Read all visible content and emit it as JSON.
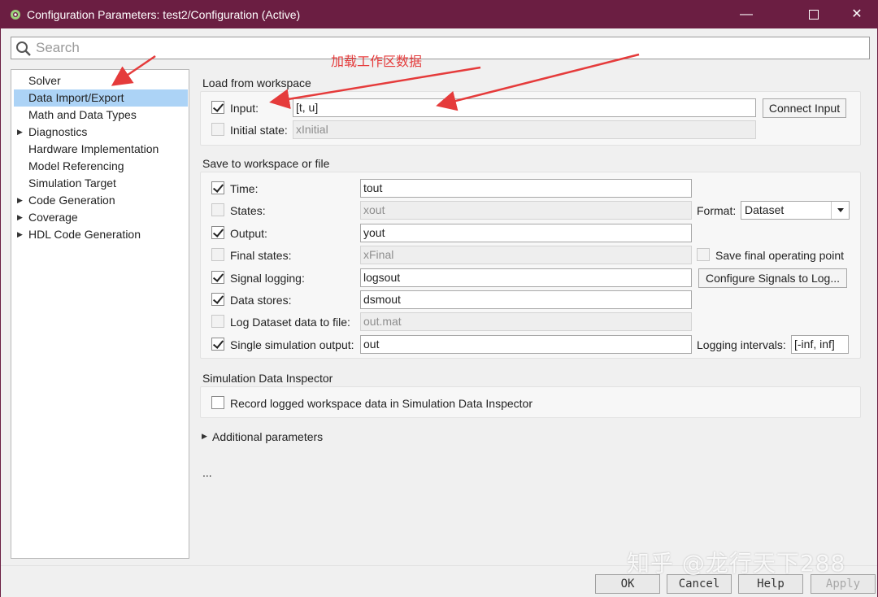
{
  "window": {
    "title": "Configuration Parameters: test2/Configuration (Active)"
  },
  "search": {
    "placeholder": "Search"
  },
  "tree": {
    "items": [
      {
        "label": "Solver",
        "expandable": false,
        "selected": false
      },
      {
        "label": "Data Import/Export",
        "expandable": false,
        "selected": true
      },
      {
        "label": "Math and Data Types",
        "expandable": false,
        "selected": false
      },
      {
        "label": "Diagnostics",
        "expandable": true,
        "selected": false
      },
      {
        "label": "Hardware Implementation",
        "expandable": false,
        "selected": false
      },
      {
        "label": "Model Referencing",
        "expandable": false,
        "selected": false
      },
      {
        "label": "Simulation Target",
        "expandable": false,
        "selected": false
      },
      {
        "label": "Code Generation",
        "expandable": true,
        "selected": false
      },
      {
        "label": "Coverage",
        "expandable": true,
        "selected": false
      },
      {
        "label": "HDL Code Generation",
        "expandable": true,
        "selected": false
      }
    ]
  },
  "load": {
    "section_title": "Load from workspace",
    "input": {
      "label": "Input:",
      "value": "[t, u]",
      "checked": true
    },
    "initial_state": {
      "label": "Initial state:",
      "value": "xInitial",
      "checked": false
    },
    "connect_button": "Connect Input"
  },
  "save": {
    "section_title": "Save to workspace or file",
    "time": {
      "label": "Time:",
      "value": "tout",
      "checked": true
    },
    "states": {
      "label": "States:",
      "value": "xout",
      "checked": false
    },
    "output": {
      "label": "Output:",
      "value": "yout",
      "checked": true
    },
    "final_states": {
      "label": "Final states:",
      "value": "xFinal",
      "checked": false
    },
    "signal_logging": {
      "label": "Signal logging:",
      "value": "logsout",
      "checked": true
    },
    "data_stores": {
      "label": "Data stores:",
      "value": "dsmout",
      "checked": true
    },
    "log_dataset": {
      "label": "Log Dataset data to file:",
      "value": "out.mat",
      "checked": false
    },
    "single_output": {
      "label": "Single simulation output:",
      "value": "out",
      "checked": true
    },
    "format_label": "Format:",
    "format_value": "Dataset",
    "save_final_op": "Save final operating point",
    "configure_signals_button": "Configure Signals to Log...",
    "logging_intervals_label": "Logging intervals:",
    "logging_intervals_value": "[-inf, inf]"
  },
  "sdi": {
    "section_title": "Simulation Data Inspector",
    "record_label": "Record logged workspace data in Simulation Data Inspector"
  },
  "additional": {
    "label": "Additional parameters",
    "ellipsis": "..."
  },
  "annotation": {
    "text": "加载工作区数据",
    "color": "#e53b3b"
  },
  "footer": {
    "ok": "OK",
    "cancel": "Cancel",
    "help": "Help",
    "apply": "Apply"
  },
  "watermark": "知乎 @龙行天下288",
  "colors": {
    "titlebar": "#6b1e42",
    "selection": "#acd3f6"
  }
}
